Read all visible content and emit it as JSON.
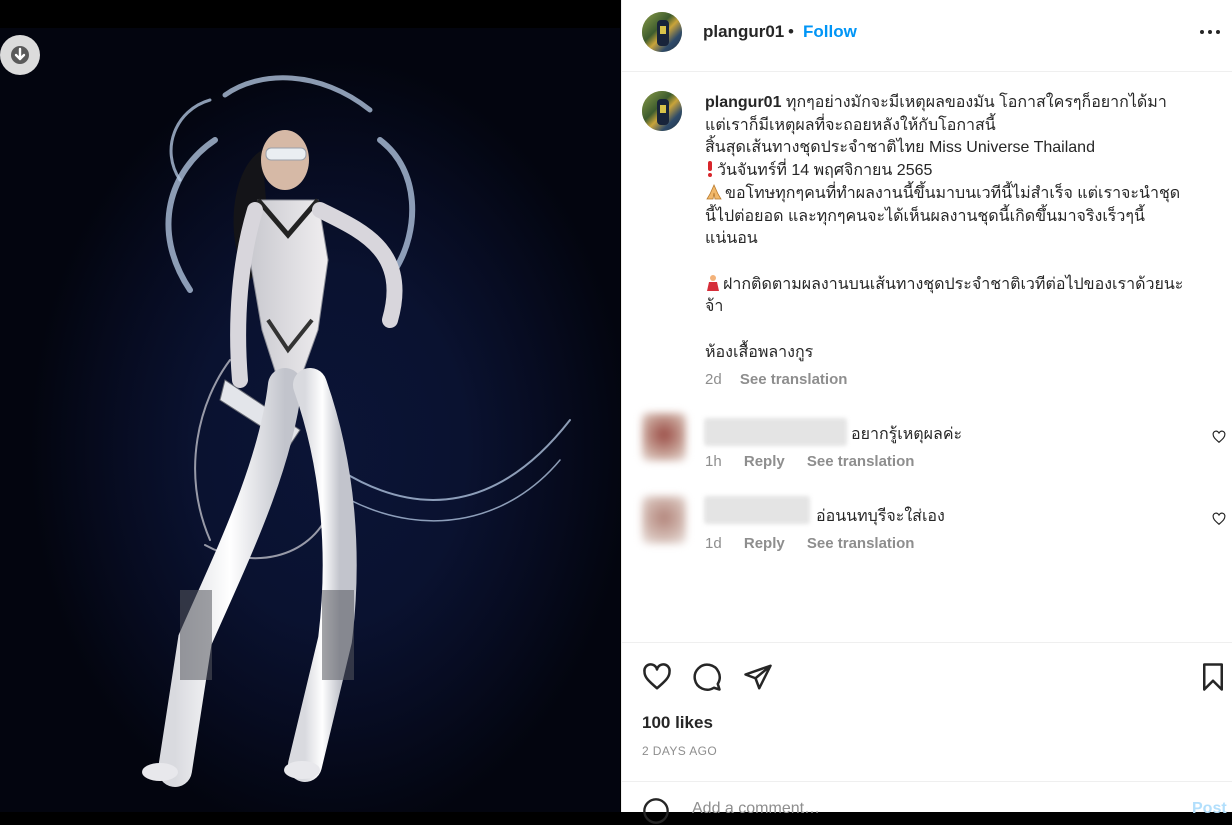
{
  "media": {
    "download_icon": "download-arrow-icon"
  },
  "header": {
    "username": "plangur01",
    "separator": "•",
    "follow_label": "Follow",
    "more_icon": "more-options-icon"
  },
  "caption": {
    "username": "plangur01",
    "line1": "ทุกๆอย่างมักจะมีเหตุผลของมัน โอกาสใครๆก็อยากได้มา",
    "line2": "แต่เราก็มีเหตุผลที่จะถอยหลังให้กับโอกาสนี้",
    "line3": "สิ้นสุดเส้นทางชุดประจำชาติไทย Miss Universe Thailand",
    "line4": "วันจันทร์ที่ 14 พฤศจิกายน 2565",
    "line5": "ขอโทษทุกๆคนที่ทำผลงานนี้ขึ้นมาบนเวทีนี้ไม่สำเร็จ แต่เราจะนำชุด",
    "line6": "นี้ไปต่อยอด และทุกๆคนจะได้เห็นผลงานชุดนี้เกิดขึ้นมาจริงเร็วๆนี้",
    "line7": "แน่นอน",
    "line8": "ฝากติดตามผลงานบนเส้นทางชุดประจำชาติเวทีต่อไปของเราด้วยนะ",
    "line9": "จ้า",
    "line10": "ห้องเสื้อพลางกูร",
    "time": "2d",
    "see_translation": "See translation"
  },
  "comments": [
    {
      "text": "อยากรู้เหตุผลค่ะ",
      "time": "1h",
      "reply": "Reply",
      "see_translation": "See translation"
    },
    {
      "text": "อ่อนนทบุรีจะใส่เอง",
      "time": "1d",
      "reply": "Reply",
      "see_translation": "See translation"
    }
  ],
  "actions": {
    "like_icon": "heart-icon",
    "comment_icon": "comment-bubble-icon",
    "share_icon": "paper-plane-icon",
    "save_icon": "bookmark-icon"
  },
  "likes": "100 likes",
  "posted": "2 DAYS AGO",
  "add_comment_placeholder": "Add a comment…",
  "post_label": "Post",
  "colors": {
    "link_blue": "#0095f6",
    "text": "#262626",
    "muted": "#8e8e8e"
  }
}
